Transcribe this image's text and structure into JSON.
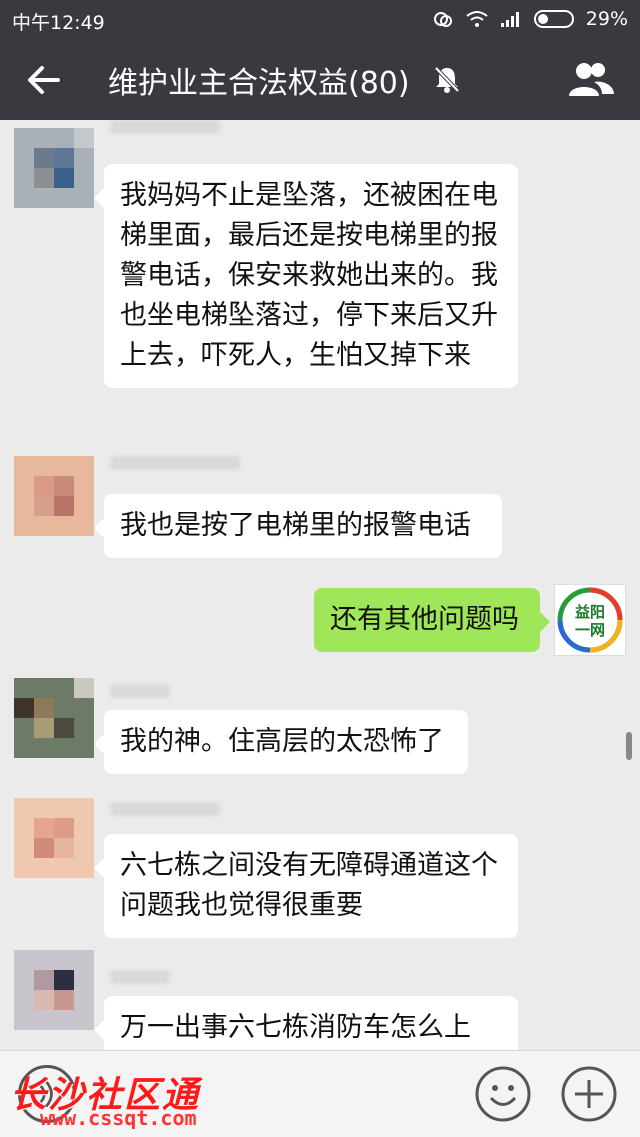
{
  "status_bar": {
    "time": "中午12:49",
    "battery": "29%"
  },
  "header": {
    "title": "维护业主合法权益(80)"
  },
  "messages": [
    {
      "side": "left",
      "text": "我妈妈不止是坠落，还被困在电梯里面，最后还是按电梯里的报警电话，保安来救她出来的。我也坐电梯坠落过，停下来后又升上去，吓死人，生怕又掉下来"
    },
    {
      "side": "left",
      "text": "我也是按了电梯里的报警电话"
    },
    {
      "side": "right",
      "text": "还有其他问题吗"
    },
    {
      "side": "left",
      "text": "我的神。住高层的太恐怖了"
    },
    {
      "side": "left",
      "text": "六七栋之间没有无障碍通道这个问题我也觉得很重要"
    },
    {
      "side": "left",
      "text": "万一出事六七栋消防车怎么上"
    }
  ],
  "logo": {
    "line1": "益阳",
    "line2": "一网"
  },
  "watermark": {
    "text": "长沙社区通",
    "url": "www.cssqt.com"
  },
  "icons": {
    "back": "back-arrow-icon",
    "mute": "mute-bell-icon",
    "members": "group-members-icon",
    "voice": "voice-icon",
    "emoji": "emoji-icon",
    "plus": "plus-icon"
  },
  "colors": {
    "nav_bg": "#393a3f",
    "chat_bg": "#ebebeb",
    "sent_bubble": "#9fe658",
    "received_bubble": "#ffffff"
  }
}
